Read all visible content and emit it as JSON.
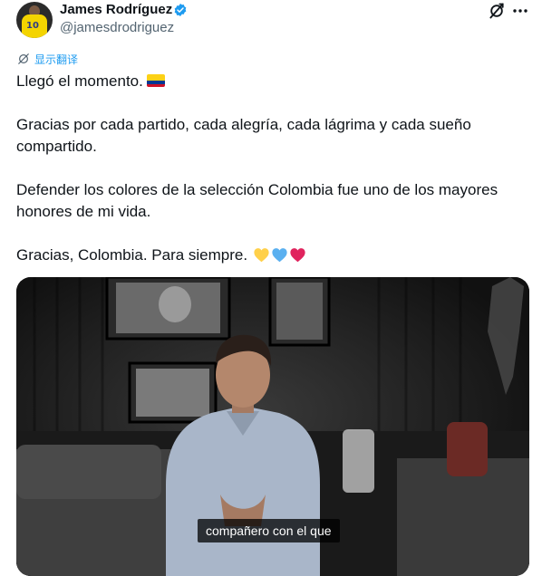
{
  "author": {
    "display_name": "James Rodríguez",
    "handle": "@jamesdrodriguez",
    "verified": true
  },
  "actions": {
    "translate_label": "显示翻译"
  },
  "tweet": {
    "line1": "Llegó el momento.",
    "line2": "Gracias por cada partido, cada alegría, cada lágrima y cada sueño compartido.",
    "line3": "Defender los colores de la selección Colombia fue uno de los mayores honores de mi vida.",
    "line4": "Gracias, Colombia. Para siempre."
  },
  "media": {
    "subtitle": "compañero con el que"
  },
  "colors": {
    "accent": "#1d9bf0",
    "verified": "#1d9bf0",
    "flag_yellow": "#fcd116",
    "flag_blue": "#003893",
    "flag_red": "#ce1126",
    "heart_yellow": "#ffd04a",
    "heart_blue": "#5ab0f0",
    "heart_red": "#e0245e"
  },
  "icons": {
    "flag": "colombia-flag-icon",
    "hearts": [
      "yellow-heart-icon",
      "blue-heart-icon",
      "red-heart-icon"
    ]
  }
}
